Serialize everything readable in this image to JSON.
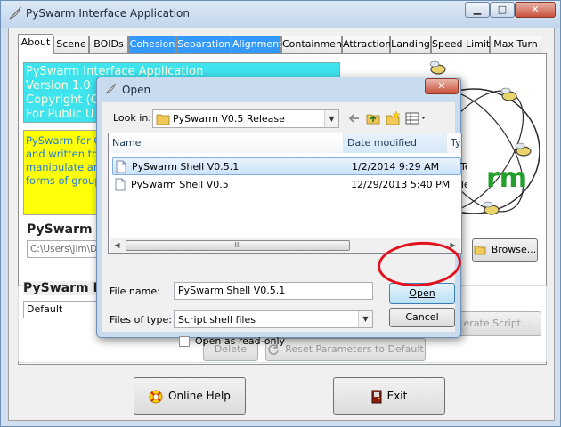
{
  "main": {
    "title": "PySwarm Interface Application",
    "tabs": [
      "About",
      "Scene",
      "BOIDs",
      "Cohesion",
      "Separation",
      "Alignment",
      "Containment",
      "Attraction",
      "Landing",
      "Speed Limit",
      "Max Turn"
    ],
    "selected_tab": "About",
    "about_cyan_lines": [
      "PySwarm Interface Application",
      "Version 1.0",
      "Copyright (C",
      "For Public U"
    ],
    "about_yellow_lines": [
      "PySwarm for C",
      "and written to",
      "manipulate an",
      "forms of group"
    ],
    "logo_text": "rm",
    "script_folder_label": "PySwarm Sc",
    "script_folder_value": "C:\\Users\\Jim\\Do",
    "browse_label": "Browse...",
    "profile_label": "PySwarm Pro",
    "profile_value": "Default",
    "generate_label": "erate Script...",
    "delete_label": "Delete",
    "reset_label": "Reset Parameters to Default",
    "help_label": "Online Help",
    "exit_label": "Exit",
    "colors": {
      "cyan_box": "#3fe3ee",
      "yellow_box": "#ffff0a",
      "tab_highlight": "#3399ff",
      "annotation_circle": "#e3101c"
    }
  },
  "dialog": {
    "title": "Open",
    "look_in_label": "Look in:",
    "look_in_value": "PySwarm V0.5 Release",
    "columns": [
      "Name",
      "Date modified",
      "Ty"
    ],
    "files": [
      {
        "name": "PySwarm Shell V0.5.1",
        "date": "1/2/2014 9:29 AM",
        "type": "Te",
        "selected": true
      },
      {
        "name": "PySwarm Shell V0.5",
        "date": "12/29/2013 5:40 PM",
        "type": "Te",
        "selected": false
      }
    ],
    "file_name_label": "File name:",
    "file_name_value": "PySwarm Shell V0.5.1",
    "files_of_type_label": "Files of type:",
    "files_of_type_value": "Script shell files",
    "open_label": "Open",
    "cancel_label": "Cancel",
    "read_only_label": "Open as read-only",
    "scroll_thumb_grip": "III"
  },
  "icons": {
    "app": "feather-icon",
    "folder": "folder-icon",
    "file": "document-icon",
    "help": "help-icon",
    "exit": "exit-door-icon",
    "reset": "refresh-icon",
    "back": "back-arrow-icon",
    "up": "up-folder-icon",
    "new_folder": "new-folder-icon",
    "views": "view-menu-icon"
  }
}
